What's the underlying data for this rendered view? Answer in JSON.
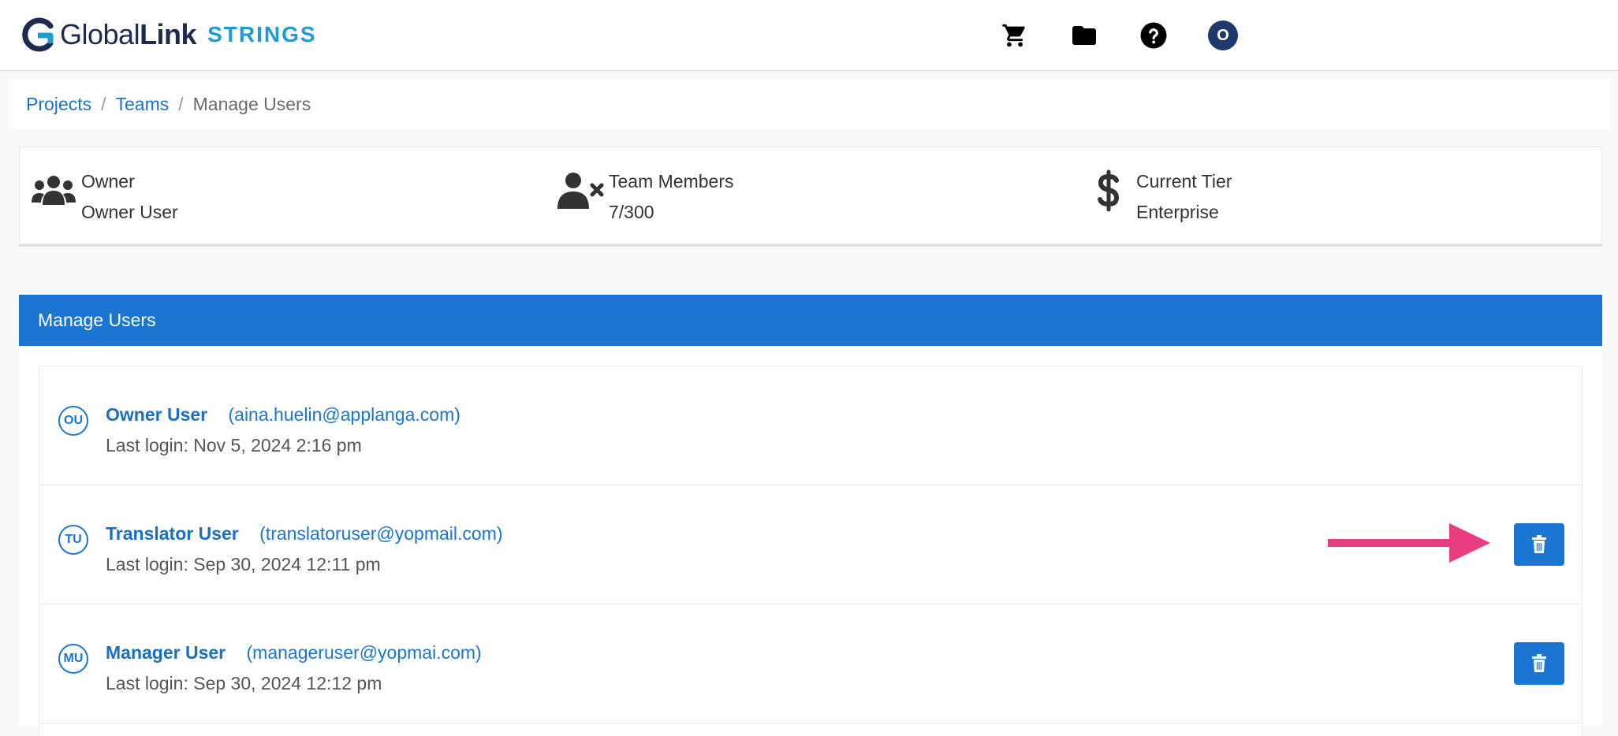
{
  "header": {
    "brand_light": "Global",
    "brand_bold": "Link",
    "product": "STRINGS",
    "icons": [
      "cart-icon",
      "folder-icon",
      "help-icon",
      "user-avatar"
    ],
    "avatar_initial": "O"
  },
  "breadcrumb": {
    "items": [
      "Projects",
      "Teams"
    ],
    "separator": "/",
    "current": "Manage Users"
  },
  "info": {
    "owner": {
      "label": "Owner",
      "value": "Owner User",
      "icon": "users-icon"
    },
    "members": {
      "label": "Team Members",
      "value": "7/300",
      "icon": "user-remove-icon"
    },
    "tier": {
      "label": "Current Tier",
      "value": "Enterprise",
      "icon": "dollar-icon"
    }
  },
  "panel": {
    "title": "Manage Users"
  },
  "users": [
    {
      "initials": "OU",
      "name": "Owner User",
      "email": "(aina.huelin@applanga.com)",
      "last_login": "Last login: Nov 5, 2024 2:16 pm",
      "deletable": false
    },
    {
      "initials": "TU",
      "name": "Translator User",
      "email": "(translatoruser@yopmail.com)",
      "last_login": "Last login: Sep 30, 2024 12:11 pm",
      "deletable": true
    },
    {
      "initials": "MU",
      "name": "Manager User",
      "email": "(manageruser@yopmai.com)",
      "last_login": "Last login: Sep 30, 2024 12:12 pm",
      "deletable": true
    }
  ],
  "colors": {
    "primary": "#1a76d2",
    "navy": "#1d2b4f",
    "accent_cyan": "#1e9ad6",
    "annotation_arrow": "#e83e7f"
  }
}
